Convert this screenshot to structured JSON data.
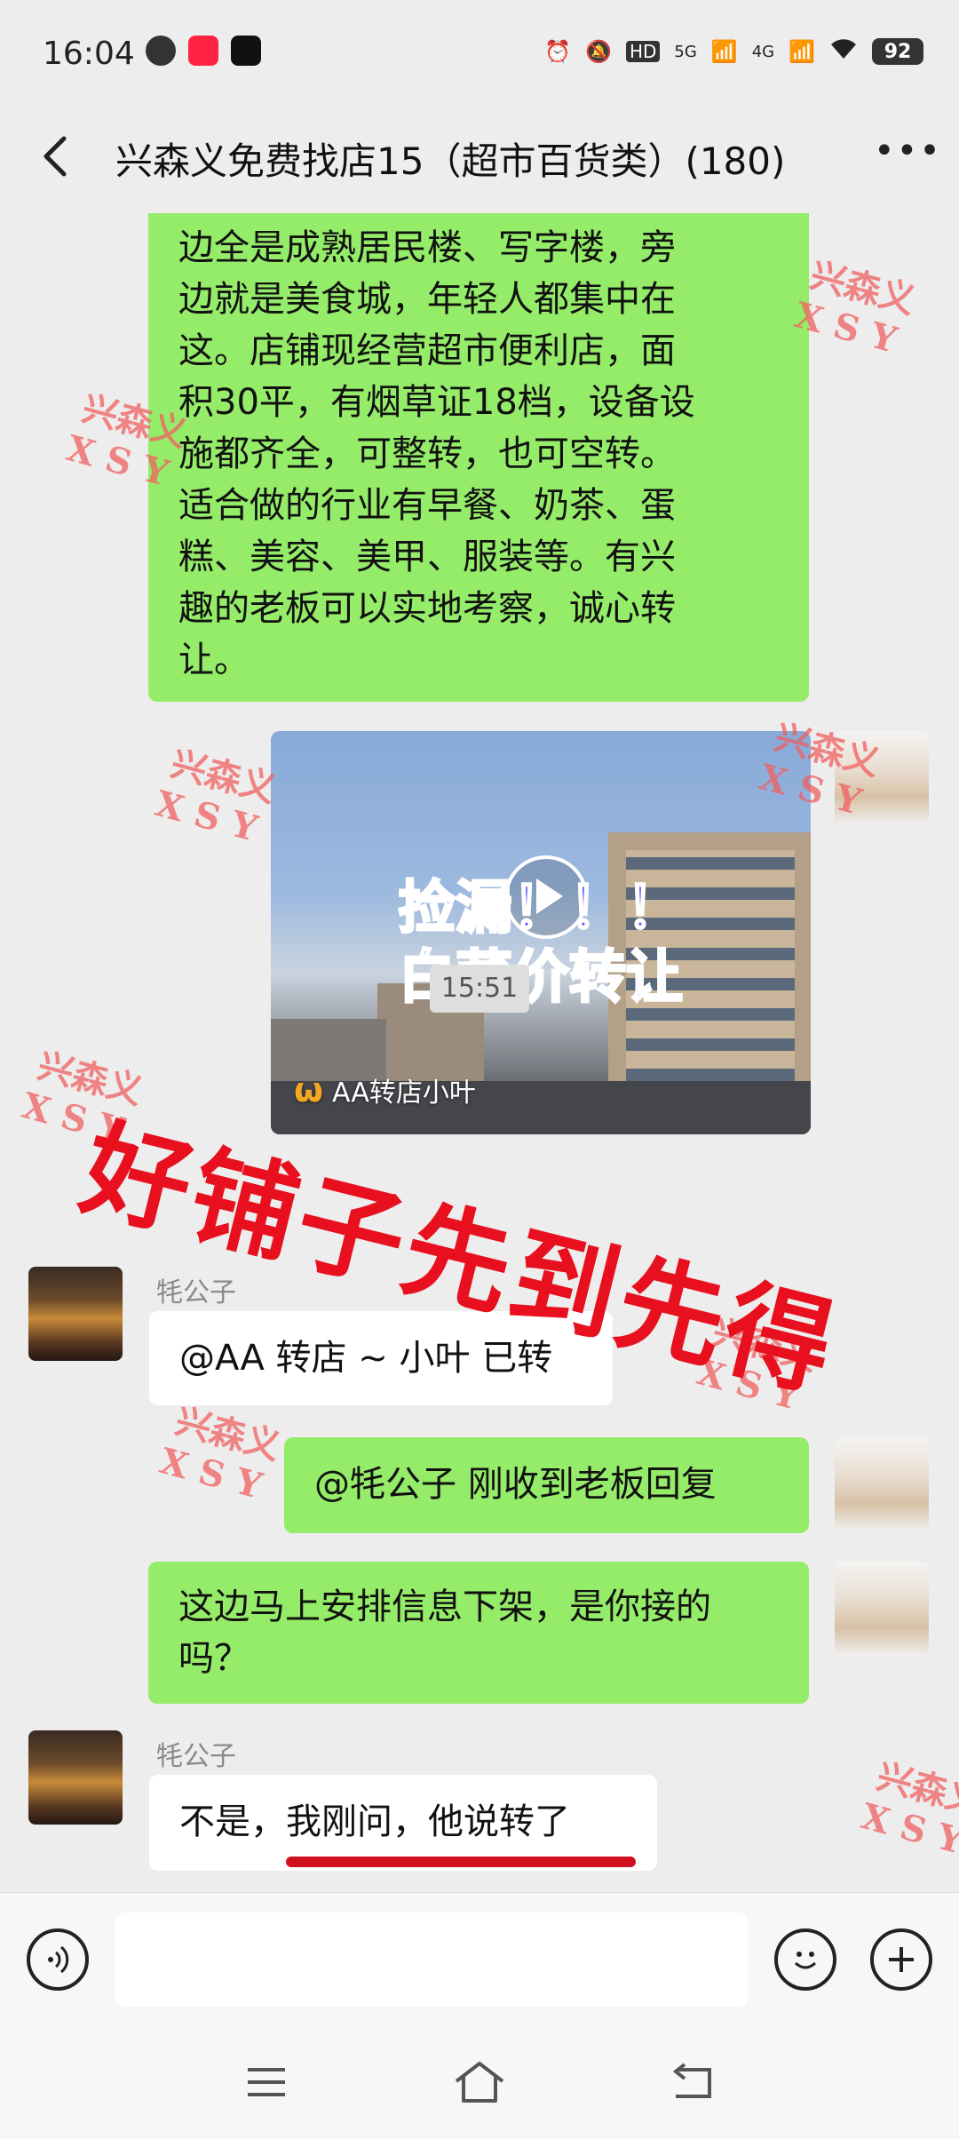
{
  "status_bar": {
    "time": "16:04",
    "network_5g": "5G",
    "network_4g": "4G",
    "hd": "HD",
    "battery": "92"
  },
  "header": {
    "title": "兴森义免费找店15（超市百货类）(180)"
  },
  "messages": {
    "m1_lines": [
      "边全是成熟居民楼、写字楼，旁",
      "边就是美食城，年轻人都集中在",
      "这。店铺现经营超市便利店，面",
      "积30平，有烟草证18档，设备设",
      "施都齐全，可整转，也可空转。",
      "适合做的行业有早餐、奶茶、蛋",
      "糕、美容、美甲、服装等。有兴",
      "趣的老板可以实地考察，诚心转",
      "让。"
    ],
    "video": {
      "title_line1": "捡漏！！！",
      "title_line2": "白菜价转让",
      "source": "AA转店小叶"
    },
    "timestamp": "15:51",
    "m2_sender": "牦公子",
    "m2_text": "@AA 转店 ~ 小叶  已转",
    "m3_text": "@牦公子  刚收到老板回复",
    "m4_lines": [
      "这边马上安排信息下架，是你接的",
      "吗？"
    ],
    "m5_sender": "牦公子",
    "m5_text": "不是，我刚问，他说转了"
  },
  "overlay_text": "好铺子先到先得",
  "watermark": {
    "line1": "兴森义",
    "line2": "XSY"
  },
  "colors": {
    "green_bubble": "#95ec69",
    "overlay_red": "#e8101e",
    "watermark_red": "#f06060",
    "background": "#ededed"
  },
  "icons": {
    "back": "chevron-left-icon",
    "more": "more-dots-icon",
    "voice": "voice-icon",
    "emoji": "emoji-icon",
    "add": "plus-icon"
  }
}
